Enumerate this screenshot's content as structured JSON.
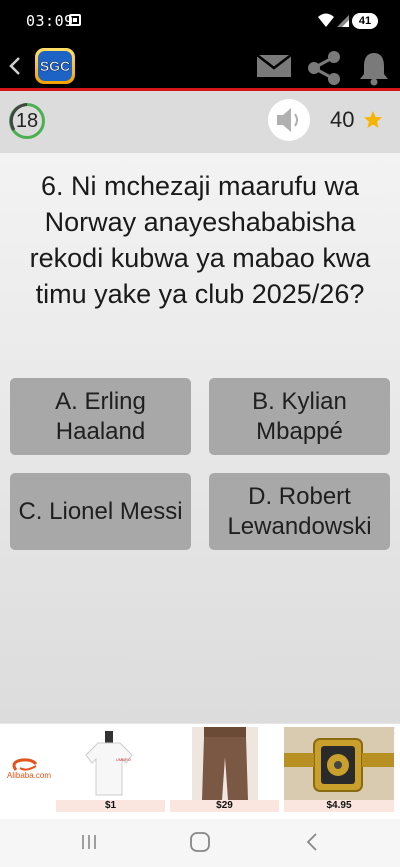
{
  "status_bar": {
    "time": "03:09",
    "battery": "41"
  },
  "app_bar": {
    "logo_text": "SGC"
  },
  "game": {
    "timer": "18",
    "score": "40"
  },
  "question": {
    "text": "6. Ni mchezaji maarufu wa Norway anayeshababisha rekodi kubwa ya mabao kwa timu yake ya club 2025/26?"
  },
  "answers": [
    {
      "letter": "A",
      "label": "A. Erling Haaland"
    },
    {
      "letter": "B",
      "label": "B. Kylian Mbappé"
    },
    {
      "letter": "C",
      "label": "C. Lionel Messi"
    },
    {
      "letter": "D",
      "label": "D. Robert Lewandowski"
    }
  ],
  "ad": {
    "brand": "Alibaba.com",
    "products": [
      {
        "name": "white-tshirt",
        "price": "$1"
      },
      {
        "name": "brown-trousers",
        "price": "$29"
      },
      {
        "name": "gold-watch",
        "price": "$4.95"
      }
    ]
  },
  "colors": {
    "accent_red": "#d4161b",
    "answer_bg": "#a8a8a8",
    "star": "#f5b400"
  }
}
